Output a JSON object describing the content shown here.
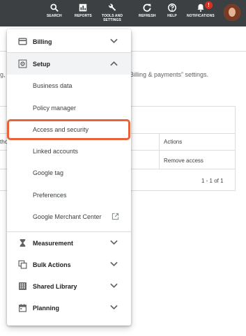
{
  "toolbar": {
    "search": "SEARCH",
    "reports": "REPORTS",
    "tools_line1": "TOOLS AND",
    "tools_line2": "SETTINGS",
    "refresh": "REFRESH",
    "help": "HELP",
    "notifications": "NOTIFICATIONS",
    "notification_count": "!"
  },
  "background": {
    "settings_text": "Billing & payments” settings.",
    "left_text": "g,",
    "actions_header": "Actions",
    "left_header": "tho",
    "remove_access": "Remove access",
    "pagination": "1 - 1 of 1"
  },
  "menu": {
    "billing": "Billing",
    "setup": "Setup",
    "setup_items": [
      "Business data",
      "Policy manager",
      "Access and security",
      "Linked accounts",
      "Google tag",
      "Preferences",
      "Google Merchant Center"
    ],
    "measurement": "Measurement",
    "bulk_actions": "Bulk Actions",
    "shared_library": "Shared Library",
    "planning": "Planning"
  },
  "colors": {
    "toolbar_bg": "#3c4043",
    "highlight_border": "#e8623a",
    "badge": "#d93025"
  }
}
